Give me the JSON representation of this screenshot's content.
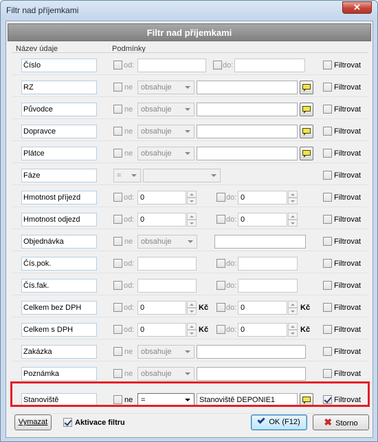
{
  "window": {
    "title": "Filtr nad příjemkami",
    "close_glyph": "✕"
  },
  "header": {
    "title": "Filtr nad příjemkami"
  },
  "columns": {
    "name": "Název údaje",
    "conditions": "Podmínky"
  },
  "labels": {
    "od": "od:",
    "do": "do:",
    "ne": "ne",
    "filter": "Filtrovat",
    "kc": "Kč"
  },
  "rows": [
    {
      "name": "Číslo"
    },
    {
      "name": "RZ",
      "op": "obsahuje"
    },
    {
      "name": "Původce",
      "op": "obsahuje"
    },
    {
      "name": "Dopravce",
      "op": "obsahuje"
    },
    {
      "name": "Plátce",
      "op": "obsahuje"
    },
    {
      "name": "Fáze",
      "op": "="
    },
    {
      "name": "Hmotnost příjezd",
      "from": "0",
      "to": "0"
    },
    {
      "name": "Hmotnost odjezd",
      "from": "0",
      "to": "0"
    },
    {
      "name": "Objednávka",
      "op": "obsahuje"
    },
    {
      "name": "Čís.pok."
    },
    {
      "name": "Čís.fak."
    },
    {
      "name": "Celkem bez DPH",
      "from": "0",
      "to": "0"
    },
    {
      "name": "Celkem s DPH",
      "from": "0",
      "to": "0"
    },
    {
      "name": "Zakázka",
      "op": "obsahuje"
    },
    {
      "name": "Poznámka",
      "op": "obsahuje"
    },
    {
      "name": "Stanoviště",
      "op": "=",
      "value": "Stanoviště DEPONIE1",
      "filter_checked": true
    }
  ],
  "footer": {
    "clear_label": "Vymazat",
    "activate_label": "Aktivace filtru",
    "activate_checked": true,
    "ok_label": "OK (F12)",
    "cancel_label": "Storno"
  },
  "colors": {
    "highlight": "#e41e26",
    "header_bar": "#8c8c8c",
    "frame": "#c9d9ec"
  }
}
